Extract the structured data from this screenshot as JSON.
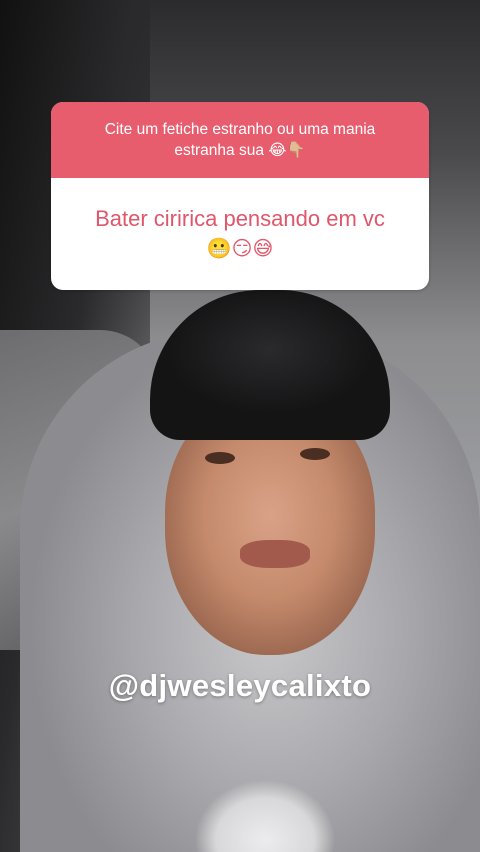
{
  "question_sticker": {
    "question": "Cite um fetiche estranho ou uma mania estranha sua 😂👇🏼",
    "answer": "Bater ciririca pensando em vc",
    "answer_emoji": "😬😏😅"
  },
  "mention": "@djwesleycalixto",
  "colors": {
    "sticker_header": "#e85d6e",
    "answer_text": "#e0566a"
  }
}
